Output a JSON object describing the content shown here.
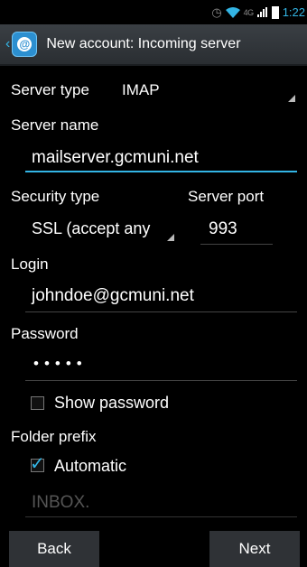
{
  "status": {
    "network": "4G",
    "time": "1:22"
  },
  "header": {
    "title": "New account: Incoming server"
  },
  "form": {
    "server_type_label": "Server type",
    "server_type_value": "IMAP",
    "server_name_label": "Server name",
    "server_name_value": "mailserver.gcmuni.net",
    "security_type_label": "Security type",
    "security_type_value": "SSL (accept any",
    "server_port_label": "Server port",
    "server_port_value": "993",
    "login_label": "Login",
    "login_value": "johndoe@gcmuni.net",
    "password_label": "Password",
    "password_value": "•••••",
    "show_password_label": "Show password",
    "folder_prefix_label": "Folder prefix",
    "automatic_label": "Automatic",
    "folder_prefix_placeholder": "INBOX."
  },
  "buttons": {
    "back": "Back",
    "next": "Next"
  },
  "colors": {
    "accent": "#33b5e5"
  }
}
